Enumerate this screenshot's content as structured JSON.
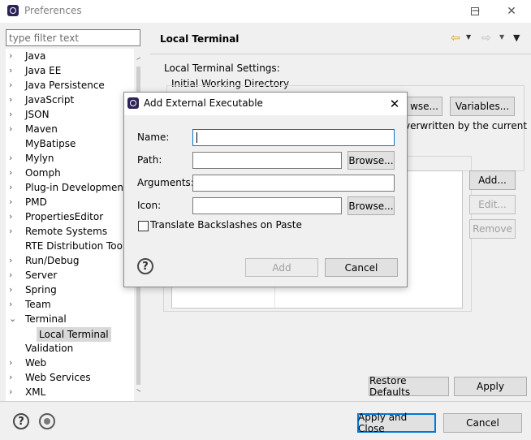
{
  "window": {
    "title": "Preferences"
  },
  "sidebar": {
    "filter_placeholder": "type filter text",
    "items": [
      {
        "label": "Java",
        "arrow": "›"
      },
      {
        "label": "Java EE",
        "arrow": "›"
      },
      {
        "label": "Java Persistence",
        "arrow": "›"
      },
      {
        "label": "JavaScript",
        "arrow": "›"
      },
      {
        "label": "JSON",
        "arrow": "›"
      },
      {
        "label": "Maven",
        "arrow": "›"
      },
      {
        "label": "MyBatipse",
        "arrow": ""
      },
      {
        "label": "Mylyn",
        "arrow": "›"
      },
      {
        "label": "Oomph",
        "arrow": "›"
      },
      {
        "label": "Plug-in Development",
        "arrow": "›"
      },
      {
        "label": "PMD",
        "arrow": "›"
      },
      {
        "label": "PropertiesEditor",
        "arrow": "›"
      },
      {
        "label": "Remote Systems",
        "arrow": "›"
      },
      {
        "label": "RTE Distribution Tool",
        "arrow": ""
      },
      {
        "label": "Run/Debug",
        "arrow": "›"
      },
      {
        "label": "Server",
        "arrow": "›"
      },
      {
        "label": "Spring",
        "arrow": "›"
      },
      {
        "label": "Team",
        "arrow": "›"
      },
      {
        "label": "Terminal",
        "arrow": "⌄"
      },
      {
        "label": "Local Terminal",
        "arrow": "",
        "selected": true
      },
      {
        "label": "Validation",
        "arrow": ""
      },
      {
        "label": "Web",
        "arrow": "›"
      },
      {
        "label": "Web Services",
        "arrow": "›"
      },
      {
        "label": "XML",
        "arrow": "›"
      }
    ]
  },
  "page": {
    "title": "Local Terminal",
    "settings_label": "Local Terminal Settings:",
    "initial_dir_label": "Initial Working Directory",
    "browse_label": "wse...",
    "variables_label": "Variables...",
    "overwritten_text": "verwritten by the current",
    "add_label": "Add...",
    "edit_label": "Edit...",
    "remove_label": "Remove",
    "restore_defaults_label": "Restore Defaults",
    "apply_label": "Apply"
  },
  "footer": {
    "apply_close_label": "Apply and Close",
    "cancel_label": "Cancel"
  },
  "dialog": {
    "title": "Add External Executable",
    "name_label": "Name:",
    "path_label": "Path:",
    "arguments_label": "Arguments:",
    "icon_label": "Icon:",
    "browse_label": "Browse...",
    "checkbox_label": "Translate Backslashes on Paste",
    "add_label": "Add",
    "cancel_label": "Cancel",
    "name_value": "",
    "path_value": "",
    "arguments_value": "",
    "icon_value": ""
  }
}
